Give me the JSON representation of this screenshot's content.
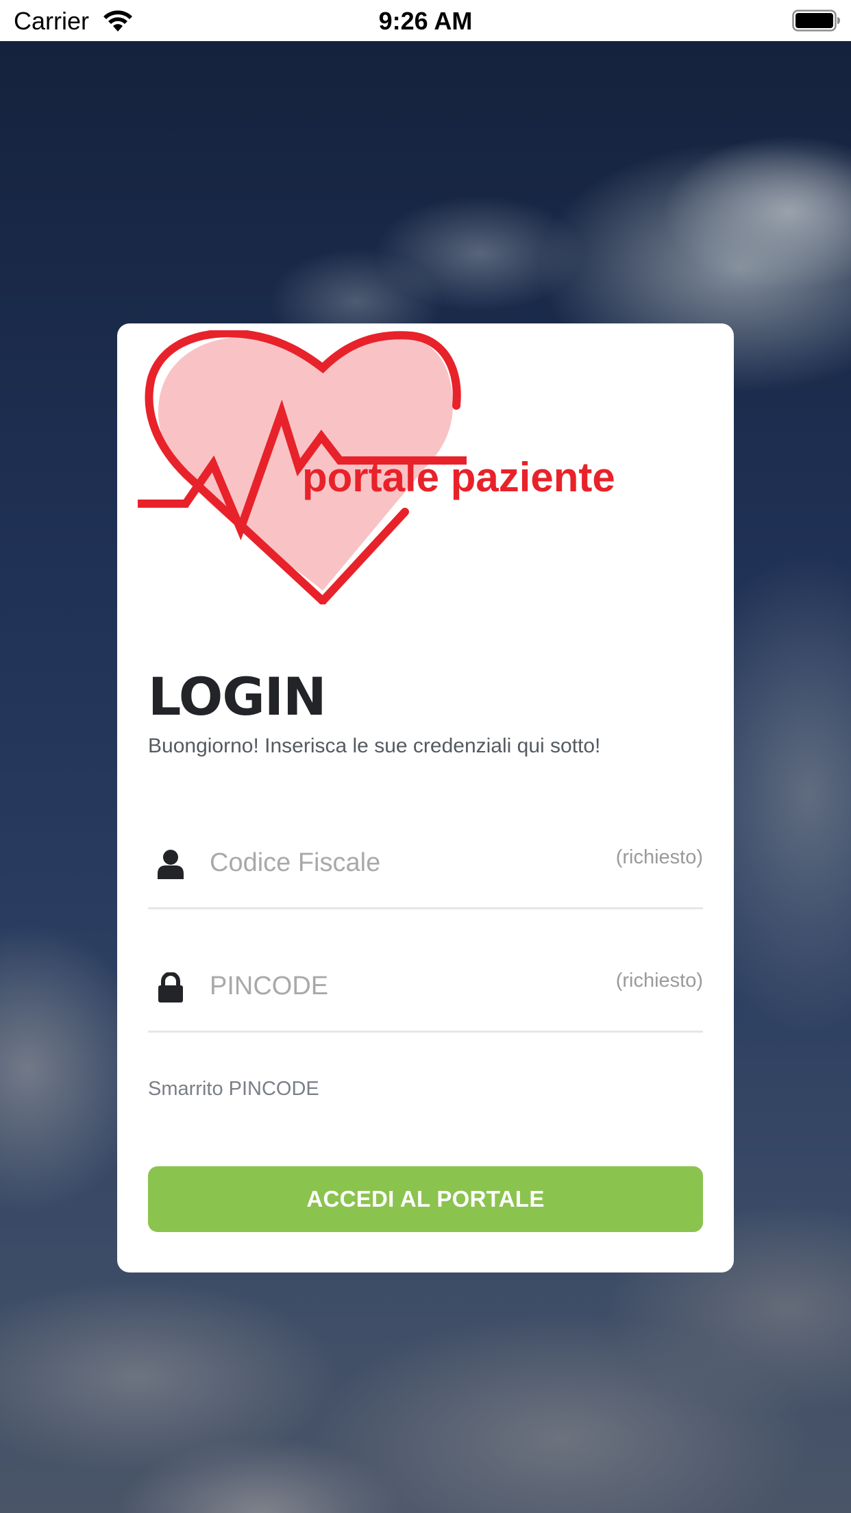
{
  "status_bar": {
    "carrier": "Carrier",
    "time": "9:26 AM",
    "wifi_icon": "wifi-icon",
    "battery_icon": "battery-full-icon"
  },
  "card": {
    "logo_text": "portale paziente",
    "title": "LOGIN",
    "subtitle": "Buongiorno! Inserisca le sue credenziali qui sotto!",
    "fields": [
      {
        "icon": "user-icon",
        "placeholder": "Codice Fiscale",
        "required_label": "(richiesto)"
      },
      {
        "icon": "lock-icon",
        "placeholder": "PINCODE",
        "required_label": "(richiesto)"
      }
    ],
    "lost_pin_link": "Smarrito PINCODE",
    "submit_label": "ACCEDI AL PORTALE"
  },
  "colors": {
    "accent_green": "#8bc34f",
    "logo_red": "#e8222a",
    "logo_pink": "#f9c3c6",
    "title_dark": "#222428"
  }
}
